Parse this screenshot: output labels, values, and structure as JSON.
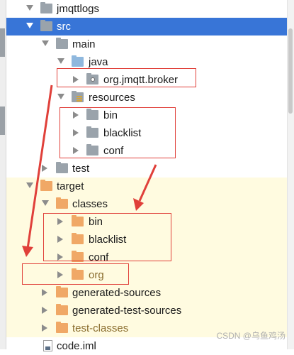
{
  "tree": {
    "items": [
      {
        "label": "jmqttlogs",
        "icon": "folder-icon"
      },
      {
        "label": "src",
        "icon": "folder-icon"
      },
      {
        "label": "main",
        "icon": "folder-icon"
      },
      {
        "label": "java",
        "icon": "source-folder-icon"
      },
      {
        "label": "org.jmqtt.broker",
        "icon": "package-icon"
      },
      {
        "label": "resources",
        "icon": "resources-folder-icon"
      },
      {
        "label": "bin",
        "icon": "folder-icon"
      },
      {
        "label": "blacklist",
        "icon": "folder-icon"
      },
      {
        "label": "conf",
        "icon": "folder-icon"
      },
      {
        "label": "test",
        "icon": "folder-icon"
      },
      {
        "label": "target",
        "icon": "excluded-folder-icon"
      },
      {
        "label": "classes",
        "icon": "excluded-folder-icon"
      },
      {
        "label": "bin",
        "icon": "excluded-folder-icon"
      },
      {
        "label": "blacklist",
        "icon": "excluded-folder-icon"
      },
      {
        "label": "conf",
        "icon": "excluded-folder-icon"
      },
      {
        "label": "org",
        "icon": "excluded-folder-icon"
      },
      {
        "label": "generated-sources",
        "icon": "excluded-folder-icon"
      },
      {
        "label": "generated-test-sources",
        "icon": "excluded-folder-icon"
      },
      {
        "label": "test-classes",
        "icon": "excluded-folder-icon"
      },
      {
        "label": "code.iml",
        "icon": "iml-file-icon"
      }
    ]
  },
  "watermark": "CSDN @乌鱼鸡汤",
  "colors": {
    "selection": "#3875d7",
    "excluded_background": "#fffbe0",
    "annotation": "#e0403a",
    "excluded_folder": "#f0a866",
    "folder": "#9aa3ab"
  }
}
